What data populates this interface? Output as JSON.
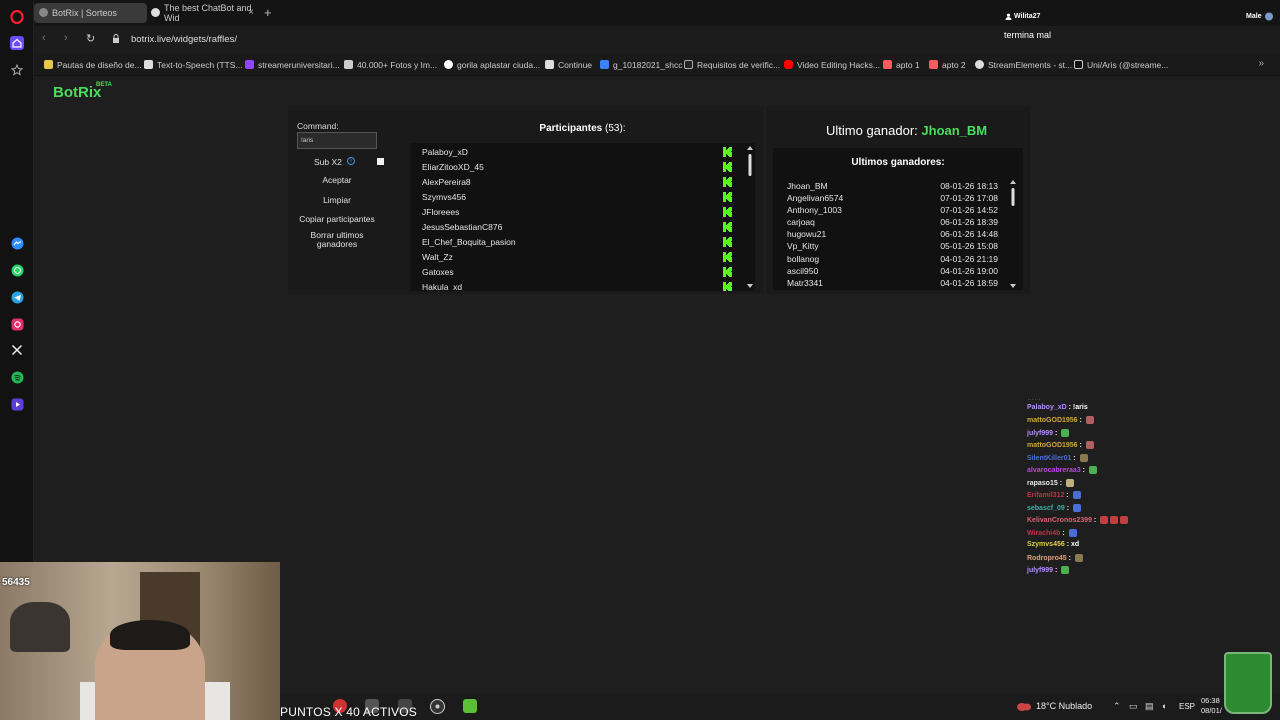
{
  "browser": {
    "tabs": [
      {
        "title": "BotRix | Sorteos"
      },
      {
        "title": "The best ChatBot and Wid"
      }
    ],
    "url": "botrix.live/widgets/raffles/",
    "bookmarks": [
      "Pautas de diseño de...",
      "Text-to-Speech (TTS...",
      "streameruniversitari...",
      "40.000+ Fotos y Im...",
      "gorila aplastar ciuda...",
      "Continue",
      "g_10182021_shcc",
      "Requisitos de verific...",
      "Video Editing Hacks...",
      "apto 1",
      "apto 2",
      "StreamElements - st...",
      "Uni/Aris (@streame..."
    ]
  },
  "app": {
    "brand": "BotRix",
    "beta": "BETA"
  },
  "controls": {
    "command_label": "Command:",
    "command_value": "!aris",
    "sub_x2": "Sub X2",
    "accept": "Aceptar",
    "clear": "Limpiar",
    "copy": "Copiar participantes",
    "delete_winners": "Borrar ultimos ganadores"
  },
  "participants": {
    "title": "Participantes",
    "count": "(53):",
    "names": [
      "Palaboy_xD",
      "EliarZitooXD_45",
      "AlexPereira8",
      "Szymvs456",
      "JFloreees",
      "JesusSebastianC876",
      "El_Chef_Boquita_pasion",
      "Walt_Zz",
      "Gatoxes",
      "Hakula_xd"
    ]
  },
  "winners": {
    "last_label": "Ultimo ganador:",
    "last_name": "Jhoan_BM",
    "list_title": "Ultimos ganadores:",
    "rows": [
      {
        "name": "Jhoan_BM",
        "date": "08-01-26 18:13"
      },
      {
        "name": "Angelivan6574",
        "date": "07-01-26 17:08"
      },
      {
        "name": "Anthony_1003",
        "date": "07-01-26 14:52"
      },
      {
        "name": "carjoaq",
        "date": "06-01-26 18:39"
      },
      {
        "name": "hugowu21",
        "date": "06-01-26 14:48"
      },
      {
        "name": "Vp_Kitty",
        "date": "05-01-26 15:08"
      },
      {
        "name": "bollanog",
        "date": "04-01-26 21:19"
      },
      {
        "name": "ascil950",
        "date": "04-01-26 19:00"
      },
      {
        "name": "Matr3341",
        "date": "04-01-26 18:59"
      }
    ]
  },
  "overlay": {
    "top_user": "Wilita27",
    "top_message": "termina mal",
    "top_right": "Male",
    "viewer_count": "56435",
    "ticker": "PUNTOS X 40 ACTIVOS",
    "chat": [
      {
        "user": "Palaboy_xD",
        "color": "#b48cff",
        "msg": "!aris",
        "emotes": []
      },
      {
        "user": "mattoGOD1956",
        "color": "#d4a63a",
        "msg": "",
        "emotes": [
          "#b06060"
        ]
      },
      {
        "user": "julyf999",
        "color": "#b48cff",
        "msg": "",
        "emotes": [
          "#4caf50"
        ]
      },
      {
        "user": "mattoGOD1956",
        "color": "#d4a63a",
        "msg": "",
        "emotes": [
          "#b06060"
        ]
      },
      {
        "user": "SilentKiller01",
        "color": "#4a6fd4",
        "msg": "",
        "emotes": [
          "#8a7a50"
        ]
      },
      {
        "user": "alvarocabreraa3",
        "color": "#b448e0",
        "msg": "",
        "emotes": [
          "#4caf50"
        ]
      },
      {
        "user": "rapaso15",
        "color": "#e8e8e8",
        "msg": "",
        "emotes": [
          "#c0b080"
        ]
      },
      {
        "user": "Erifamil312",
        "color": "#c0304a",
        "msg": "",
        "emotes": [
          "#4a6fd4"
        ]
      },
      {
        "user": "sebascf_09",
        "color": "#3ab0a0",
        "msg": "",
        "emotes": [
          "#4a6fd4"
        ]
      },
      {
        "user": "KelivanCronos2399",
        "color": "#e0607a",
        "msg": "",
        "emotes": [
          "#c04040",
          "#c04040",
          "#c04040"
        ]
      },
      {
        "user": "Wirachi4b",
        "color": "#c0304a",
        "msg": "",
        "emotes": [
          "#4a6fd4"
        ]
      },
      {
        "user": "Szymvs456",
        "color": "#e0d040",
        "msg": "xd",
        "emotes": []
      },
      {
        "user": "Rodropro45",
        "color": "#e0a080",
        "msg": "",
        "emotes": [
          "#8a7a50"
        ]
      },
      {
        "user": "julyf999",
        "color": "#b48cff",
        "msg": "",
        "emotes": [
          "#4caf50"
        ]
      }
    ]
  },
  "system": {
    "weather": "18°C Nublado",
    "lang": "ESP",
    "time": "06:38",
    "date": "08/01/"
  },
  "colors": {
    "accent_green": "#4ade5c",
    "kick_green": "#53fc18"
  }
}
